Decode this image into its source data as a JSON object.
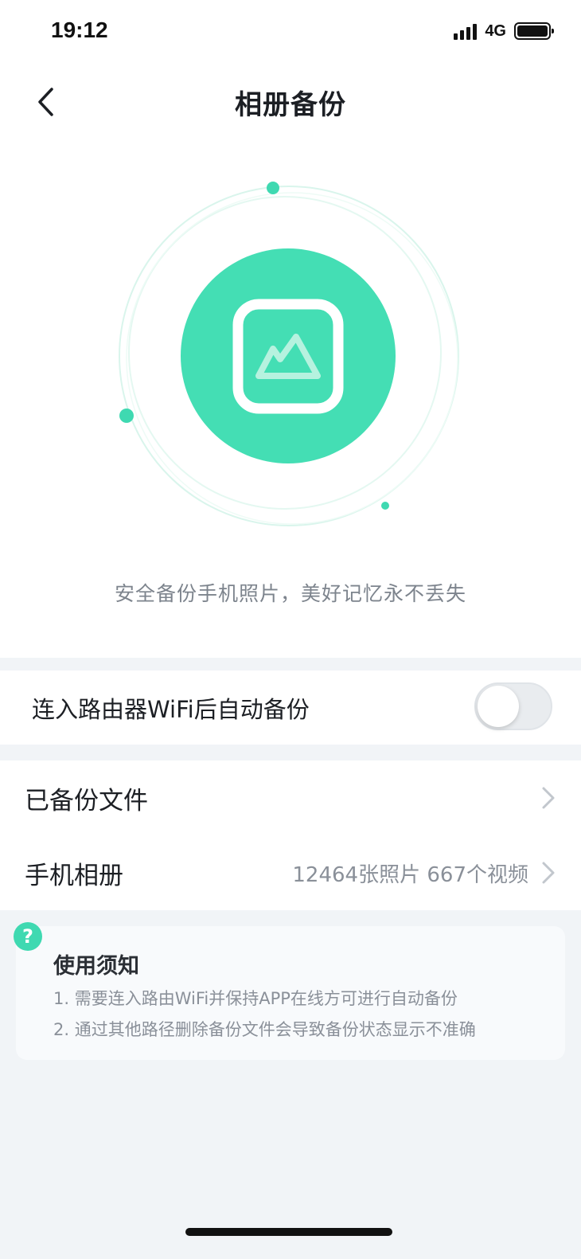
{
  "status_bar": {
    "time": "19:12",
    "network": "4G"
  },
  "nav": {
    "title": "相册备份"
  },
  "hero": {
    "tagline": "安全备份手机照片，美好记忆永不丢失"
  },
  "auto_backup": {
    "label": "连入路由器WiFi后自动备份",
    "enabled": false
  },
  "list": {
    "backed_up_files": {
      "label": "已备份文件"
    },
    "phone_album": {
      "label": "手机相册",
      "summary": "12464张照片 667个视频"
    }
  },
  "notice": {
    "badge": "?",
    "title": "使用须知",
    "lines": [
      "1. 需要连入路由WiFi并保持APP在线方可进行自动备份",
      "2. 通过其他路径删除备份文件会导致备份状态显示不准确"
    ]
  },
  "colors": {
    "accent": "#3fd9b1",
    "background": "#f1f4f7"
  }
}
